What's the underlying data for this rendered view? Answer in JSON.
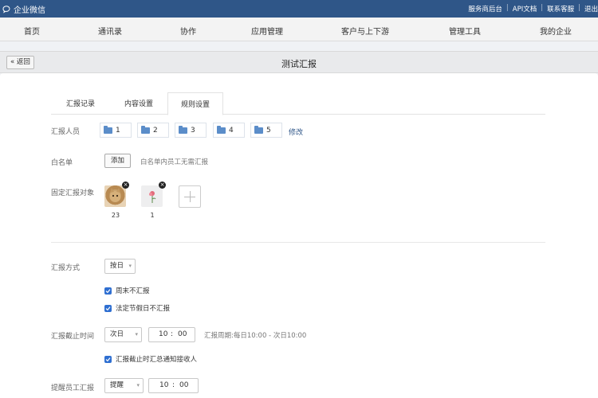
{
  "topbar": {
    "brand": "企业微信",
    "links": [
      "服务商后台",
      "API文档",
      "联系客服",
      "退出"
    ],
    "separator": "|"
  },
  "nav": {
    "items": [
      "首页",
      "通讯录",
      "协作",
      "应用管理",
      "客户与上下游",
      "管理工具",
      "我的企业"
    ]
  },
  "header": {
    "back_label": "« 返回",
    "title": "测试汇报"
  },
  "tabs": {
    "records": "汇报记录",
    "content": "内容设置",
    "rules": "规则设置"
  },
  "reporters": {
    "label": "汇报人员",
    "chips": [
      "1",
      "2",
      "3",
      "4",
      "5"
    ],
    "edit": "修改"
  },
  "whitelist": {
    "label": "白名单",
    "add_button": "添加",
    "hint": "白名单内员工无需汇报"
  },
  "targets": {
    "label": "固定汇报对象",
    "people": [
      {
        "name": "23",
        "icon": "cat-avatar"
      },
      {
        "name": "1",
        "icon": "flower-avatar"
      }
    ],
    "remove_glyph": "×"
  },
  "method": {
    "label": "汇报方式",
    "value": "按日",
    "caret": "▾",
    "options": [
      {
        "label": "周末不汇报",
        "checked": true
      },
      {
        "label": "法定节假日不汇报",
        "checked": true
      }
    ]
  },
  "deadline": {
    "label": "汇报截止时间",
    "day": "次日",
    "hour": "10",
    "colon": ":",
    "minute": "00",
    "hint": "汇报周期:每日10:00 - 次日10:00",
    "notify": {
      "label": "汇报截止时汇总通知接收人",
      "checked": true
    }
  },
  "reminder": {
    "label": "提醒员工汇报",
    "value": "提醒",
    "hour": "10",
    "minute": "00"
  },
  "colors": {
    "topbar": "#2f5688",
    "accent": "#2f6fd1",
    "link": "#2f5688"
  }
}
